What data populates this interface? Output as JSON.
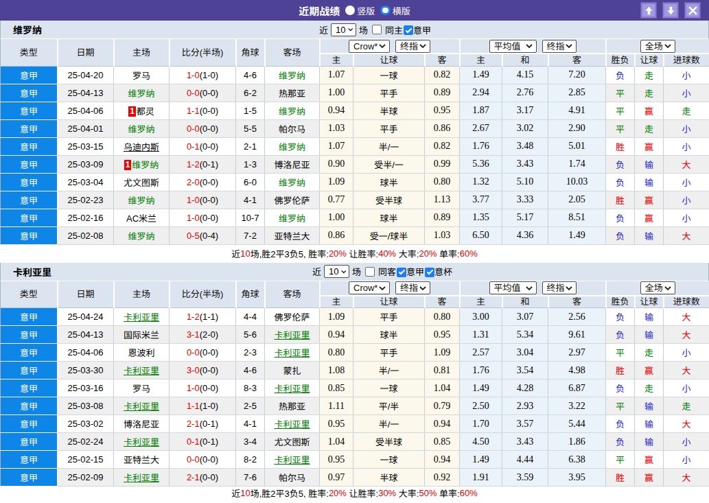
{
  "title_bar": {
    "title": "近期战绩",
    "radio_vertical_label": "竖版",
    "radio_horizontal_label": "横版",
    "selected_layout": "横版",
    "buttons": {
      "up": "up-arrow",
      "down": "down-arrow",
      "close": "close-x"
    },
    "bar_color": "#4e4296"
  },
  "table_header": {
    "cols": [
      "类型",
      "日期",
      "主场",
      "比分(半场)",
      "角球",
      "客场"
    ],
    "odds_group": {
      "select1": "Crow*",
      "select2": "终指",
      "sub": [
        "主",
        "让球",
        "客"
      ]
    },
    "avg_group": {
      "select1": "平均值",
      "select2": "终指",
      "sub": [
        "主",
        "和",
        "客"
      ]
    },
    "full_group": {
      "select1": "全场",
      "sub": [
        "胜负",
        "让球",
        "进球数"
      ]
    }
  },
  "colors": {
    "league_blue": "#0d86e8",
    "cream": "#fdf8ec",
    "pale_blue": "#eaf3fa",
    "green": "#008000",
    "red": "#e60000",
    "result_blue": "#2323d3",
    "panel": "#dce4ef",
    "alt_row": "#efefef"
  },
  "blocks": [
    {
      "team": "维罗纳",
      "controls": {
        "near": "近",
        "count": "10",
        "unit": "场",
        "same": {
          "label": "同主",
          "checked": false
        },
        "filters": [
          {
            "label": "意甲",
            "checked": true
          }
        ]
      },
      "rows": [
        {
          "league": "意甲",
          "date": "25-04-20",
          "home": {
            "t": "罗马"
          },
          "score": "1-0",
          "half": "(1-0)",
          "corner": "4-6",
          "away": {
            "t": "维罗纳",
            "g": 1
          },
          "odds": [
            "1.07",
            "一球",
            "0.82"
          ],
          "avg": [
            "1.49",
            "4.15",
            "7.20"
          ],
          "res": [
            [
              "负",
              "b"
            ],
            [
              "走",
              "g"
            ],
            [
              "小",
              "b"
            ]
          ]
        },
        {
          "league": "意甲",
          "date": "25-04-13",
          "home": {
            "t": "维罗纳",
            "g": 1
          },
          "score": "0-0",
          "half": "(0-0)",
          "corner": "6-2",
          "away": {
            "t": "热那亚"
          },
          "odds": [
            "1.00",
            "平手",
            "0.89"
          ],
          "avg": [
            "2.94",
            "2.76",
            "2.85"
          ],
          "res": [
            [
              "平",
              "g"
            ],
            [
              "走",
              "g"
            ],
            [
              "小",
              "b"
            ]
          ]
        },
        {
          "league": "意甲",
          "date": "25-04-06",
          "home": {
            "t": "都灵",
            "badge": "1"
          },
          "score": "1-1",
          "half": "(0-0)",
          "corner": "1-5",
          "away": {
            "t": "维罗纳",
            "g": 1
          },
          "odds": [
            "0.94",
            "半球",
            "0.95"
          ],
          "avg": [
            "1.87",
            "3.17",
            "4.91"
          ],
          "res": [
            [
              "平",
              "g"
            ],
            [
              "赢",
              "r"
            ],
            [
              "走",
              "g"
            ]
          ]
        },
        {
          "league": "意甲",
          "date": "25-04-01",
          "home": {
            "t": "维罗纳",
            "g": 1
          },
          "score": "0-0",
          "half": "(0-0)",
          "corner": "5-5",
          "away": {
            "t": "帕尔马"
          },
          "odds": [
            "1.03",
            "平手",
            "0.86"
          ],
          "avg": [
            "2.67",
            "3.02",
            "2.90"
          ],
          "res": [
            [
              "平",
              "g"
            ],
            [
              "走",
              "g"
            ],
            [
              "小",
              "b"
            ]
          ]
        },
        {
          "league": "意甲",
          "date": "25-03-15",
          "home": {
            "t": "乌迪内斯",
            "u": 1
          },
          "score": "0-1",
          "half": "(0-0)",
          "corner": "2-1",
          "away": {
            "t": "维罗纳",
            "g": 1
          },
          "odds": [
            "1.07",
            "半/一",
            "0.82"
          ],
          "avg": [
            "1.76",
            "3.48",
            "5.01"
          ],
          "res": [
            [
              "胜",
              "r"
            ],
            [
              "赢",
              "r"
            ],
            [
              "小",
              "b"
            ]
          ]
        },
        {
          "league": "意甲",
          "date": "25-03-09",
          "home": {
            "t": "维罗纳",
            "g": 1,
            "badge": "1"
          },
          "score": "1-2",
          "half": "(0-1)",
          "corner": "1-3",
          "away": {
            "t": "博洛尼亚"
          },
          "odds": [
            "0.90",
            "受半/一",
            "0.99"
          ],
          "avg": [
            "5.36",
            "3.43",
            "1.74"
          ],
          "res": [
            [
              "负",
              "b"
            ],
            [
              "输",
              "b"
            ],
            [
              "大",
              "r"
            ]
          ]
        },
        {
          "league": "意甲",
          "date": "25-03-04",
          "home": {
            "t": "尤文图斯"
          },
          "score": "2-0",
          "half": "(0-0)",
          "corner": "6-0",
          "away": {
            "t": "维罗纳",
            "g": 1
          },
          "odds": [
            "1.09",
            "球半",
            "0.80"
          ],
          "avg": [
            "1.32",
            "5.10",
            "10.03"
          ],
          "res": [
            [
              "负",
              "b"
            ],
            [
              "输",
              "b"
            ],
            [
              "小",
              "b"
            ]
          ]
        },
        {
          "league": "意甲",
          "date": "25-02-23",
          "home": {
            "t": "维罗纳",
            "g": 1
          },
          "score": "1-0",
          "half": "(0-0)",
          "corner": "4-1",
          "away": {
            "t": "佛罗伦萨"
          },
          "odds": [
            "0.77",
            "受半球",
            "1.13"
          ],
          "avg": [
            "3.77",
            "3.33",
            "2.05"
          ],
          "res": [
            [
              "胜",
              "r"
            ],
            [
              "赢",
              "r"
            ],
            [
              "小",
              "b"
            ]
          ]
        },
        {
          "league": "意甲",
          "date": "25-02-16",
          "home": {
            "t": "AC米兰"
          },
          "score": "1-0",
          "half": "(0-0)",
          "corner": "10-7",
          "away": {
            "t": "维罗纳",
            "g": 1
          },
          "odds": [
            "1.00",
            "球半",
            "0.89"
          ],
          "avg": [
            "1.35",
            "5.17",
            "8.51"
          ],
          "res": [
            [
              "负",
              "b"
            ],
            [
              "赢",
              "r"
            ],
            [
              "小",
              "b"
            ]
          ]
        },
        {
          "league": "意甲",
          "date": "25-02-08",
          "home": {
            "t": "维罗纳",
            "g": 1
          },
          "score": "0-5",
          "half": "(0-4)",
          "corner": "7-2",
          "away": {
            "t": "亚特兰大"
          },
          "odds": [
            "0.86",
            "受一/球半",
            "1.03"
          ],
          "avg": [
            "6.50",
            "4.36",
            "1.49"
          ],
          "res": [
            [
              "负",
              "b"
            ],
            [
              "输",
              "b"
            ],
            [
              "大",
              "r"
            ]
          ]
        }
      ],
      "summary": [
        [
          "近",
          "k"
        ],
        [
          "10",
          "r"
        ],
        [
          "场,胜2平3负5, 胜率:",
          "k"
        ],
        [
          "20%",
          "r"
        ],
        [
          " 让胜率:",
          "k"
        ],
        [
          "40%",
          "r"
        ],
        [
          " 大率:",
          "k"
        ],
        [
          "20%",
          "r"
        ],
        [
          " 单率:",
          "k"
        ],
        [
          "60%",
          "r"
        ]
      ]
    },
    {
      "team": "卡利亚里",
      "controls": {
        "near": "近",
        "count": "10",
        "unit": "场",
        "same": {
          "label": "同客",
          "checked": false
        },
        "filters": [
          {
            "label": "意甲",
            "checked": true
          },
          {
            "label": "意杯",
            "checked": true
          }
        ]
      },
      "rows": [
        {
          "league": "意甲",
          "date": "25-04-24",
          "home": {
            "t": "卡利亚里",
            "g": 1,
            "u": 1
          },
          "score": "1-2",
          "half": "(1-1)",
          "corner": "4-4",
          "away": {
            "t": "佛罗伦萨"
          },
          "odds": [
            "1.09",
            "平手",
            "0.80"
          ],
          "avg": [
            "3.00",
            "3.07",
            "2.56"
          ],
          "res": [
            [
              "负",
              "b"
            ],
            [
              "输",
              "b"
            ],
            [
              "大",
              "r"
            ]
          ]
        },
        {
          "league": "意甲",
          "date": "25-04-13",
          "home": {
            "t": "国际米兰"
          },
          "score": "3-1",
          "half": "(2-0)",
          "corner": "5-6",
          "away": {
            "t": "卡利亚里",
            "g": 1,
            "u": 1
          },
          "odds": [
            "0.94",
            "球半",
            "0.95"
          ],
          "avg": [
            "1.31",
            "5.34",
            "9.61"
          ],
          "res": [
            [
              "负",
              "b"
            ],
            [
              "输",
              "b"
            ],
            [
              "大",
              "r"
            ]
          ]
        },
        {
          "league": "意甲",
          "date": "25-04-06",
          "home": {
            "t": "恩波利"
          },
          "score": "0-0",
          "half": "(0-0)",
          "corner": "2-3",
          "away": {
            "t": "卡利亚里",
            "g": 1,
            "u": 1
          },
          "odds": [
            "0.80",
            "平手",
            "1.09"
          ],
          "avg": [
            "2.57",
            "3.04",
            "2.97"
          ],
          "res": [
            [
              "平",
              "g"
            ],
            [
              "走",
              "g"
            ],
            [
              "小",
              "b"
            ]
          ]
        },
        {
          "league": "意甲",
          "date": "25-03-30",
          "home": {
            "t": "卡利亚里",
            "g": 1,
            "u": 1
          },
          "score": "3-0",
          "half": "(0-0)",
          "corner": "4-6",
          "away": {
            "t": "蒙扎"
          },
          "odds": [
            "1.08",
            "半/一",
            "0.81"
          ],
          "avg": [
            "1.76",
            "3.54",
            "4.98"
          ],
          "res": [
            [
              "胜",
              "r"
            ],
            [
              "赢",
              "r"
            ],
            [
              "大",
              "r"
            ]
          ]
        },
        {
          "league": "意甲",
          "date": "25-03-16",
          "home": {
            "t": "罗马"
          },
          "score": "1-0",
          "half": "(0-0)",
          "corner": "8-3",
          "away": {
            "t": "卡利亚里",
            "g": 1,
            "u": 1
          },
          "odds": [
            "0.85",
            "一球",
            "1.04"
          ],
          "avg": [
            "1.49",
            "4.28",
            "6.87"
          ],
          "res": [
            [
              "负",
              "b"
            ],
            [
              "走",
              "g"
            ],
            [
              "小",
              "b"
            ]
          ]
        },
        {
          "league": "意甲",
          "date": "25-03-08",
          "home": {
            "t": "卡利亚里",
            "g": 1,
            "u": 1
          },
          "score": "1-1",
          "half": "(1-0)",
          "corner": "2-5",
          "away": {
            "t": "热那亚"
          },
          "odds": [
            "1.11",
            "平/半",
            "0.79"
          ],
          "avg": [
            "2.50",
            "2.93",
            "3.22"
          ],
          "res": [
            [
              "平",
              "g"
            ],
            [
              "输",
              "b"
            ],
            [
              "走",
              "g"
            ]
          ]
        },
        {
          "league": "意甲",
          "date": "25-03-02",
          "home": {
            "t": "博洛尼亚"
          },
          "score": "2-1",
          "half": "(0-1)",
          "corner": "4-1",
          "away": {
            "t": "卡利亚里",
            "g": 1,
            "u": 1
          },
          "odds": [
            "0.95",
            "半/一",
            "0.94"
          ],
          "avg": [
            "1.70",
            "3.57",
            "5.44"
          ],
          "res": [
            [
              "负",
              "b"
            ],
            [
              "输",
              "b"
            ],
            [
              "大",
              "r"
            ]
          ]
        },
        {
          "league": "意甲",
          "date": "25-02-24",
          "home": {
            "t": "卡利亚里",
            "g": 1,
            "u": 1
          },
          "score": "0-1",
          "half": "(0-1)",
          "corner": "3-4",
          "away": {
            "t": "尤文图斯"
          },
          "odds": [
            "1.04",
            "受半球",
            "0.85"
          ],
          "avg": [
            "4.50",
            "3.43",
            "1.86"
          ],
          "res": [
            [
              "负",
              "b"
            ],
            [
              "输",
              "b"
            ],
            [
              "小",
              "b"
            ]
          ]
        },
        {
          "league": "意甲",
          "date": "25-02-15",
          "home": {
            "t": "亚特兰大"
          },
          "score": "0-0",
          "half": "(0-0)",
          "corner": "8-2",
          "away": {
            "t": "卡利亚里",
            "g": 1,
            "u": 1
          },
          "odds": [
            "0.95",
            "一球",
            "0.94"
          ],
          "avg": [
            "1.49",
            "4.44",
            "6.38"
          ],
          "res": [
            [
              "平",
              "g"
            ],
            [
              "赢",
              "r"
            ],
            [
              "小",
              "b"
            ]
          ]
        },
        {
          "league": "意甲",
          "date": "25-02-09",
          "home": {
            "t": "卡利亚里",
            "g": 1,
            "u": 1
          },
          "score": "2-1",
          "half": "(0-0)",
          "corner": "7-6",
          "away": {
            "t": "帕尔马"
          },
          "odds": [
            "0.97",
            "半球",
            "0.92"
          ],
          "avg": [
            "1.91",
            "3.59",
            "3.95"
          ],
          "res": [
            [
              "胜",
              "r"
            ],
            [
              "赢",
              "r"
            ],
            [
              "大",
              "r"
            ]
          ]
        }
      ],
      "summary": [
        [
          "近",
          "k"
        ],
        [
          "10",
          "r"
        ],
        [
          "场,胜2平3负5, 胜率:",
          "k"
        ],
        [
          "20%",
          "r"
        ],
        [
          " 让胜率:",
          "k"
        ],
        [
          "30%",
          "r"
        ],
        [
          " 大率:",
          "k"
        ],
        [
          "50%",
          "r"
        ],
        [
          " 单率:",
          "k"
        ],
        [
          "60%",
          "r"
        ]
      ]
    }
  ]
}
